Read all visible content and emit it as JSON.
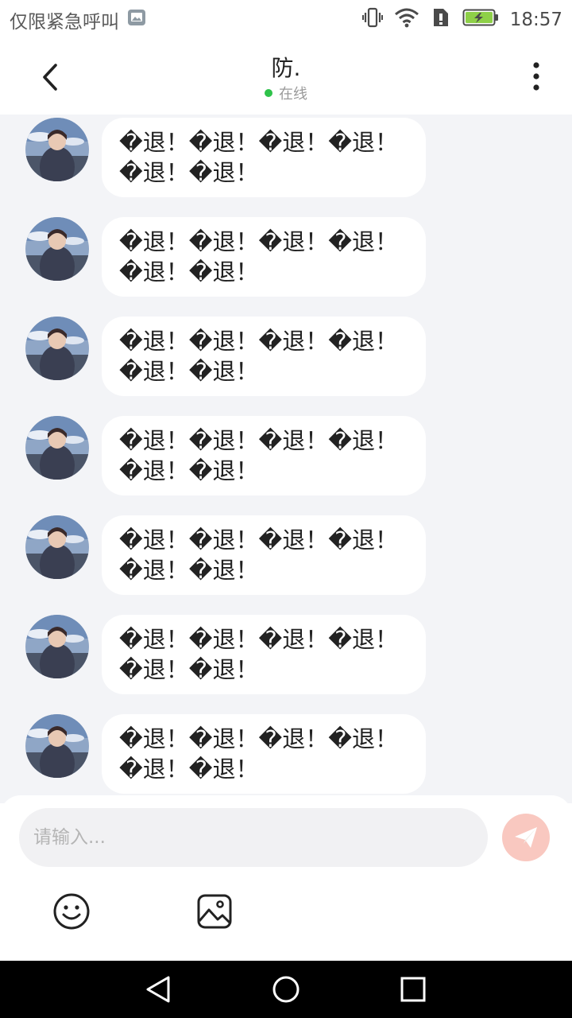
{
  "status_bar": {
    "carrier_text": "仅限紧急呼叫",
    "time": "18:57",
    "icons": [
      "image-notification-icon",
      "vibrate-icon",
      "wifi-icon",
      "sim-alert-icon",
      "battery-charging-icon"
    ]
  },
  "header": {
    "title": "防.",
    "presence": "在线",
    "presence_color": "#2ec24a",
    "back_icon": "chevron-left-icon",
    "more_icon": "more-vertical-icon"
  },
  "messages": [
    {
      "text": "�退！�退！�退！�退！�退！�退！"
    },
    {
      "text": "�退！�退！�退！�退！�退！�退！"
    },
    {
      "text": "�退！�退！�退！�退！�退！�退！"
    },
    {
      "text": "�退！�退！�退！�退！�退！�退！"
    },
    {
      "text": "�退！�退！�退！�退！�退！�退！"
    },
    {
      "text": "�退！�退！�退！�退！�退！�退！"
    },
    {
      "text": "�退！�退！�退！�退！�退！�退！"
    }
  ],
  "composer": {
    "placeholder": "请输入...",
    "send_icon": "send-plane-icon",
    "send_color": "#f9c8c0",
    "emoji_icon": "emoji-icon",
    "image_icon": "image-picker-icon"
  },
  "nav": {
    "icons": [
      "nav-back-icon",
      "nav-home-icon",
      "nav-recent-icon"
    ]
  }
}
